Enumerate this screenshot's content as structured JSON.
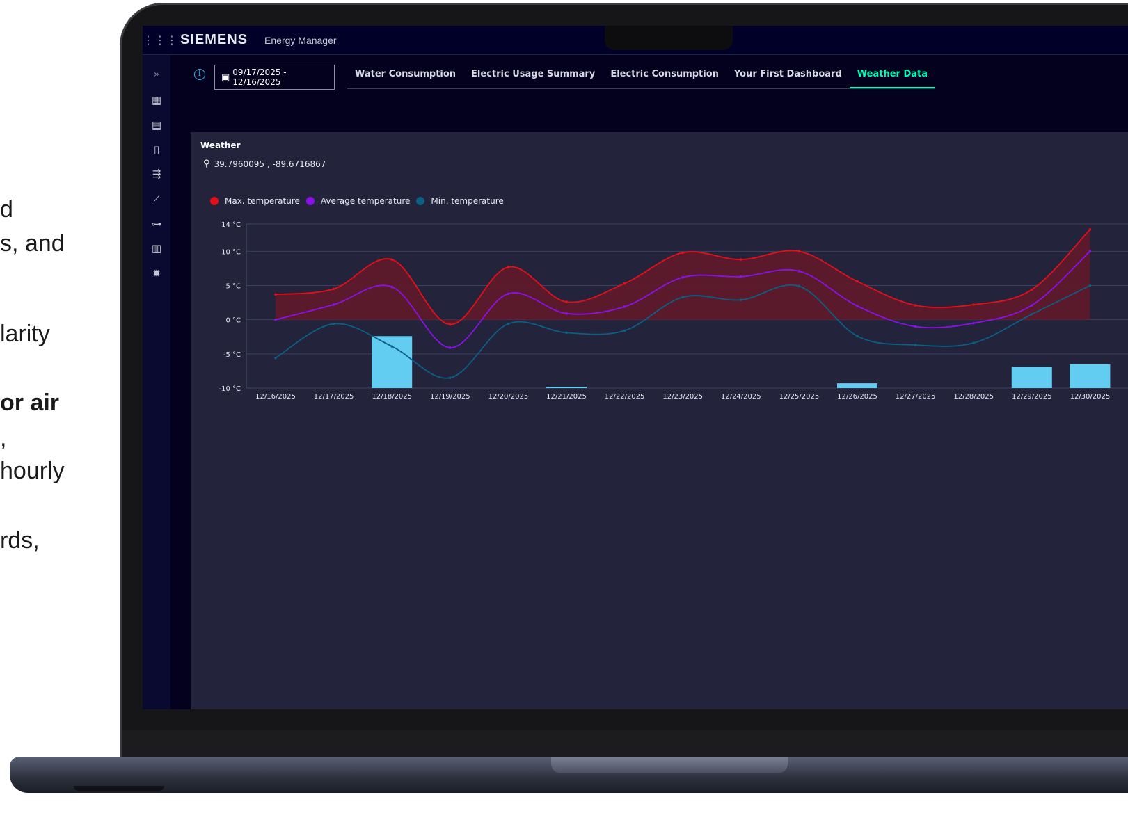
{
  "slide_fragments": [
    {
      "text": "d",
      "bold": false
    },
    {
      "text": "s, and",
      "bold": false
    },
    {
      "text": "larity",
      "bold": false
    },
    {
      "text": "or air",
      "bold": true
    },
    {
      "text": ",",
      "bold": false
    },
    {
      "text": "hourly",
      "bold": false
    },
    {
      "text": "rds,",
      "bold": false
    }
  ],
  "app": {
    "brand": "SIEMENS",
    "name": "Energy Manager",
    "apps_icon": "apps-grid-icon"
  },
  "sidebar": {
    "items": [
      {
        "icon": "expand-chevrons-icon"
      },
      {
        "icon": "dashboard-icon"
      },
      {
        "icon": "reports-icon"
      },
      {
        "icon": "document-icon"
      },
      {
        "icon": "data-points-icon"
      },
      {
        "icon": "analytics-icon"
      },
      {
        "icon": "hierarchy-icon"
      },
      {
        "icon": "buildings-icon"
      },
      {
        "icon": "settings-icon"
      }
    ]
  },
  "toolbar": {
    "info_icon": "info-icon",
    "date_range": "09/17/2025 - 12/16/2025",
    "calendar_icon": "calendar-icon"
  },
  "tabs": [
    {
      "label": "Water Consumption",
      "active": false
    },
    {
      "label": "Electric Usage Summary",
      "active": false
    },
    {
      "label": "Electric Consumption",
      "active": false
    },
    {
      "label": "Your First Dashboard",
      "active": false
    },
    {
      "label": "Weather Data",
      "active": true
    }
  ],
  "widget": {
    "title": "Weather",
    "location": "39.7960095 , -89.6716867",
    "location_icon": "location-pin-icon"
  },
  "colors": {
    "max": "#e3101a",
    "avg": "#8b11e8",
    "min": "#0b5f84",
    "bars": "#62cdf0",
    "band_fill": "#5e1a2a",
    "accent": "#00ffb9"
  },
  "chart_data": {
    "type": "line",
    "title": "",
    "xlabel": "",
    "ylabel": "",
    "categories": [
      "12/16/2025",
      "12/17/2025",
      "12/18/2025",
      "12/19/2025",
      "12/20/2025",
      "12/21/2025",
      "12/22/2025",
      "12/23/2025",
      "12/24/2025",
      "12/25/2025",
      "12/26/2025",
      "12/27/2025",
      "12/28/2025",
      "12/29/2025",
      "12/30/2025"
    ],
    "y_ticks": [
      "14 °C",
      "10 °C",
      "5 °C",
      "0 °C",
      "-5 °C",
      "-10 °C"
    ],
    "y_tick_values": [
      14,
      10,
      5,
      0,
      -5,
      -10
    ],
    "ylim": [
      -10,
      14
    ],
    "grid": true,
    "legend_position": "top-left",
    "series": [
      {
        "name": "Max. temperature",
        "color_key": "max",
        "values": [
          3.7,
          4.5,
          8.8,
          -0.7,
          7.7,
          2.6,
          5.3,
          9.8,
          8.8,
          10.0,
          5.6,
          2.1,
          2.2,
          4.4,
          13.2
        ]
      },
      {
        "name": "Average temperature",
        "color_key": "avg",
        "values": [
          0.0,
          2.2,
          4.8,
          -4.1,
          3.8,
          0.9,
          1.9,
          6.2,
          6.3,
          7.1,
          2.0,
          -1.0,
          -0.5,
          2.1,
          10.0
        ]
      },
      {
        "name": "Min. temperature",
        "color_key": "min",
        "values": [
          -5.6,
          -0.6,
          -3.9,
          -8.5,
          -0.6,
          -1.9,
          -1.6,
          3.3,
          2.9,
          4.9,
          -2.4,
          -3.7,
          -3.4,
          0.8,
          5.0
        ]
      }
    ],
    "bars": {
      "baseline": -10,
      "values": [
        null,
        null,
        -2.4,
        null,
        null,
        -9.8,
        null,
        null,
        null,
        null,
        -9.3,
        null,
        null,
        -6.9,
        -6.5
      ]
    }
  }
}
